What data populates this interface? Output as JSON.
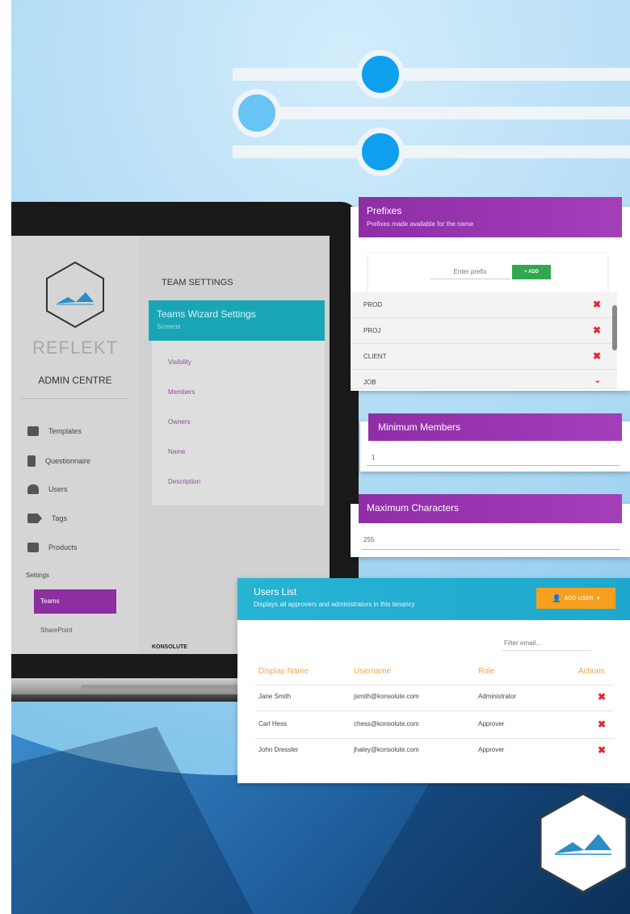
{
  "sidebar": {
    "brand": "REFLEKT",
    "subtitle": "ADMIN CENTRE",
    "items": [
      {
        "label": "Templates",
        "icon": "grid-icon"
      },
      {
        "label": "Questionnaire",
        "icon": "clipboard-icon"
      },
      {
        "label": "Users",
        "icon": "user-icon"
      },
      {
        "label": "Tags",
        "icon": "tag-icon"
      },
      {
        "label": "Products",
        "icon": "box-icon"
      }
    ],
    "settings_label": "Settings",
    "active_item": "Teams",
    "sub_item": "SharePoint"
  },
  "team_settings": {
    "title": "TEAM SETTINGS",
    "wizard_title": "Teams Wizard Settings",
    "wizard_subtitle": "Screens",
    "screens": [
      "Visibility",
      "Members",
      "Owners",
      "Name",
      "Description"
    ],
    "footer": "KONSOLUTE"
  },
  "prefixes": {
    "title": "Prefixes",
    "subtitle": "Prefixes made available for the name",
    "input_placeholder": "Enter prefix",
    "add_label": "+ ADD",
    "items": [
      "PROD",
      "PROJ",
      "CLIENT",
      "JOB"
    ]
  },
  "minimum_members": {
    "title": "Minimum Members",
    "value": "1"
  },
  "maximum_characters": {
    "title": "Maximum Characters",
    "value": "255"
  },
  "users_list": {
    "title": "Users List",
    "subtitle": "Displays all approvers and administrators in this tenancy",
    "add_user_label": "ADD USER",
    "filter_placeholder": "Filter email...",
    "columns": [
      "Display Name",
      "Username",
      "Role",
      "Actions"
    ],
    "rows": [
      {
        "name": "Jane Smith",
        "username": "jsmith@konsolute.com",
        "role": "Administrator"
      },
      {
        "name": "Carl Hess",
        "username": "chess@konsolute.com",
        "role": "Approver"
      },
      {
        "name": "John Dressler",
        "username": "jhaley@konsolute.com",
        "role": "Approver"
      }
    ]
  },
  "colors": {
    "accent_purple": "#8f2da7",
    "accent_teal": "#1aa5b5",
    "users_head": "#27b4d3",
    "add_green": "#2fa84f",
    "add_user_orange": "#f5a01e",
    "delete_red": "#e5262f"
  }
}
